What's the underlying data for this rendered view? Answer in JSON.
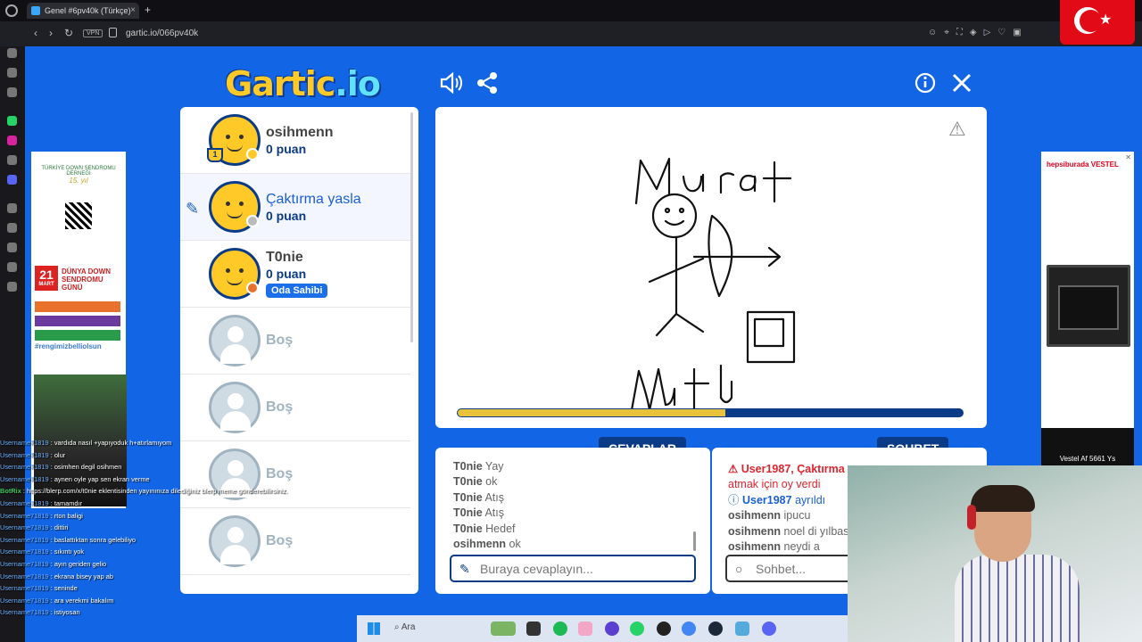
{
  "browser": {
    "tab_title": "Genel #6pv40k (Türkçe)",
    "tab_close": "×",
    "new_tab": "+",
    "nav_back": "‹",
    "nav_forward": "›",
    "nav_reload": "↻",
    "vpn": "VPN",
    "url": "gartic.io/066pv40k"
  },
  "game": {
    "logo_main": "Gartic",
    "logo_suffix": ".io",
    "icons": [
      "speaker-icon",
      "share-icon",
      "info-icon",
      "close-icon"
    ],
    "players": [
      {
        "name": "osihmenn",
        "score": "0 puan",
        "status_color": "#ffc928",
        "drawing": false
      },
      {
        "name": "Çaktırma yasla",
        "score": "0 puan",
        "status_color": "#bbbbbb",
        "drawing": true
      },
      {
        "name": "T0nie",
        "score": "0 puan",
        "status_color": "#e8722b",
        "drawing": false,
        "badge": "Oda Sahibi"
      }
    ],
    "empty_slots": [
      "Boş",
      "Boş",
      "Boş",
      "Boş"
    ],
    "timer_progress": 0.53,
    "tabs": {
      "answers": "CEVAPLAR",
      "chat": "SOHBET"
    },
    "answers": [
      {
        "user": "T0nie",
        "text": "Yay"
      },
      {
        "user": "T0nie",
        "text": "ok"
      },
      {
        "user": "T0nie",
        "text": "Atış"
      },
      {
        "user": "T0nie",
        "text": "Atış"
      },
      {
        "user": "T0nie",
        "text": "Hedef"
      },
      {
        "user": "osihmenn",
        "text": "ok"
      }
    ],
    "answer_placeholder": "Buraya cevaplayın...",
    "chat_system": [
      {
        "text": "User1987, Çaktırma",
        "type": "red"
      },
      {
        "text": "atmak için oy verdi",
        "type": "red2"
      },
      {
        "text": "User1987",
        "suffix": "ayrıldı",
        "type": "blue"
      }
    ],
    "chat": [
      {
        "user": "osihmenn",
        "text": "ipucu"
      },
      {
        "user": "osihmenn",
        "text": "noel di yılbası"
      },
      {
        "user": "osihmenn",
        "text": "neydi a"
      }
    ],
    "chat_placeholder": "Sohbet...",
    "drawing_words": [
      "Murat",
      "Mutlu"
    ]
  },
  "ads": {
    "left_title": "TÜRKİYE DOWN SENDROMU DERNEĞİ",
    "left_years": "15. yıl",
    "left_date": "21",
    "left_month": "MART",
    "left_heading": "DÜNYA DOWN SENDROMU GÜNÜ",
    "left_hashtag": "#rengimizbelliolsun",
    "right_brand": "hepsiburada VESTEL",
    "right_footer": "Vestel Af 5661 Ys"
  },
  "stream_chat": [
    {
      "user": "Username71819",
      "text": ": vardıda nasıl +yapıyoduk h+atırlamıyom"
    },
    {
      "user": "Username71819",
      "text": ": olur"
    },
    {
      "user": "Username71819",
      "text": ": osimhen degil osihmen"
    },
    {
      "user": "Username71819",
      "text": ": aynen oyle yap sen ekran verme"
    },
    {
      "user": "BotRix",
      "text": ": https://blerp.com/x/t0nie eklentisinden yayınınıza dilediğiniz blerp meme gönderebilirsiniz."
    },
    {
      "user": "Username71819",
      "text": ": tamamdır"
    },
    {
      "user": "Username71819",
      "text": ": rton baligi"
    },
    {
      "user": "Username71819",
      "text": ": dittiri"
    },
    {
      "user": "Username71819",
      "text": ": baslattıktan sonra gelebiliyo"
    },
    {
      "user": "Username71819",
      "text": ": sıkıntı yok"
    },
    {
      "user": "Username71819",
      "text": ": ayın geriden gelio"
    },
    {
      "user": "Username71819",
      "text": ": ekrana bisey yap ab"
    },
    {
      "user": "Username71819",
      "text": ": seninde"
    },
    {
      "user": "Username71819",
      "text": ": ara verekmi bakalım"
    },
    {
      "user": "Username71819",
      "text": ": istiyosan"
    }
  ],
  "taskbar": {
    "search": "Ara"
  }
}
